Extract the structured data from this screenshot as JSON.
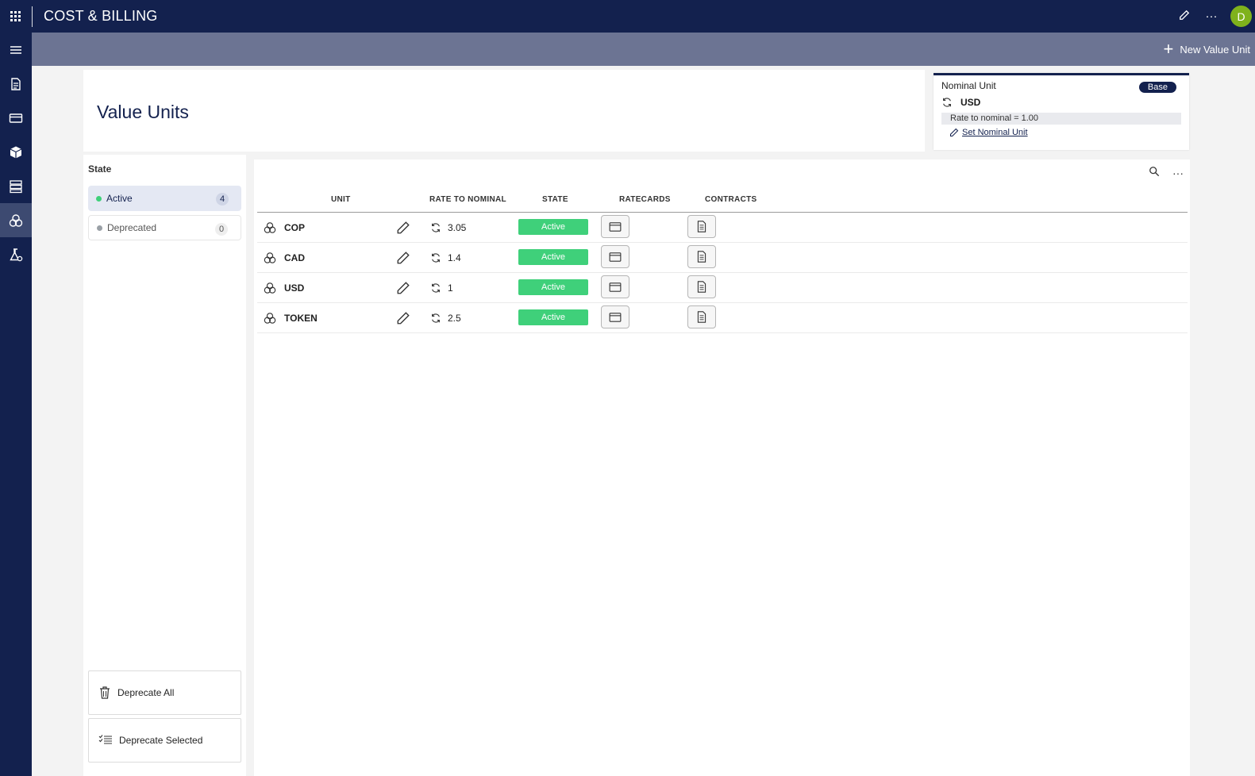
{
  "app": {
    "title": "COST & BILLING",
    "avatar_initial": "D"
  },
  "colors": {
    "navy": "#13214e",
    "command_bar": "#6c7493",
    "active_green": "#3fd07a",
    "deprecated_gray": "#9aa0a6",
    "avatar_green": "#7fb21c"
  },
  "rail": {
    "items": [
      {
        "icon": "menu-icon"
      },
      {
        "icon": "document-icon"
      },
      {
        "icon": "card-icon"
      },
      {
        "icon": "box-icon"
      },
      {
        "icon": "server-icon"
      },
      {
        "icon": "value-units-icon",
        "active": true
      },
      {
        "icon": "flask-gear-icon"
      }
    ]
  },
  "command_bar": {
    "new_button": "New Value Unit"
  },
  "page": {
    "title": "Value Units"
  },
  "nominal": {
    "label": "Nominal Unit",
    "badge": "Base",
    "unit": "USD",
    "rate": "Rate to nominal = 1.00",
    "set_link": "Set Nominal Unit"
  },
  "state_filter": {
    "title": "State",
    "items": [
      {
        "label": "Active",
        "count": "4"
      },
      {
        "label": "Deprecated",
        "count": "0"
      }
    ],
    "deprecate_all": "Deprecate All",
    "deprecate_selected": "Deprecate Selected"
  },
  "table": {
    "headers": {
      "unit": "UNIT",
      "rate": "RATE TO NOMINAL",
      "state": "STATE",
      "ratecards": "RATECARDS",
      "contracts": "CONTRACTS"
    },
    "rows": [
      {
        "unit": "COP",
        "rate": "3.05",
        "state": "Active"
      },
      {
        "unit": "CAD",
        "rate": "1.4",
        "state": "Active"
      },
      {
        "unit": "USD",
        "rate": "1",
        "state": "Active"
      },
      {
        "unit": "TOKEN",
        "rate": "2.5",
        "state": "Active"
      }
    ]
  }
}
